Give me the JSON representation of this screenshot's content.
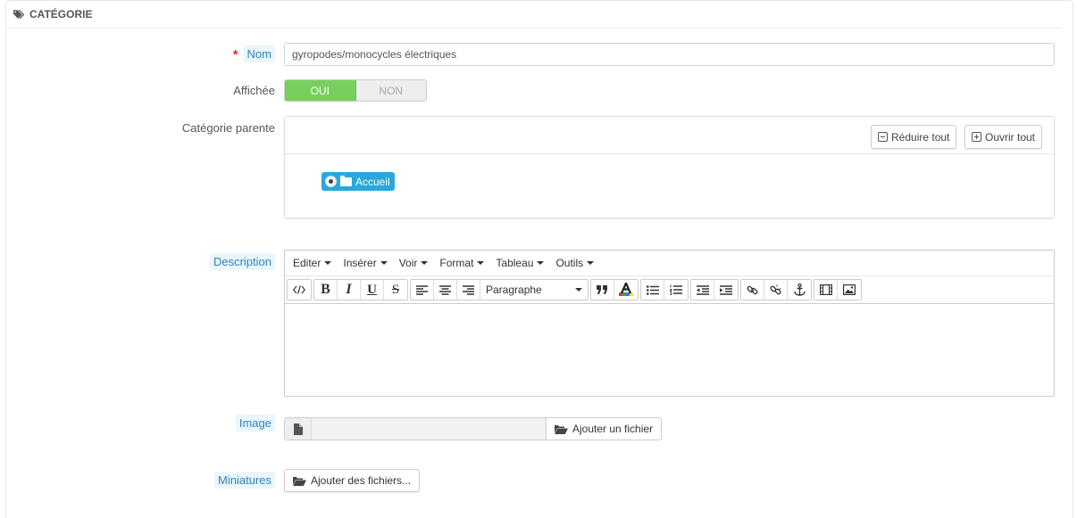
{
  "panel": {
    "heading": "CATÉGORIE",
    "icon": "tag-icon"
  },
  "fields": {
    "name": {
      "label": "Nom",
      "required_mark": "*",
      "value": "gyropodes/monocycles électriques"
    },
    "displayed": {
      "label": "Affichée",
      "on_label": "OUI",
      "off_label": "NON",
      "state": "on"
    },
    "parent": {
      "label": "Catégorie parente",
      "collapse_all": "Réduire tout",
      "expand_all": "Ouvrir tout",
      "node": "Accueil"
    },
    "description": {
      "label": "Description",
      "menus": [
        "Editer",
        "Insérer",
        "Voir",
        "Format",
        "Tableau",
        "Outils"
      ],
      "format_select": "Paragraphe"
    },
    "image": {
      "label": "Image",
      "button": "Ajouter un fichier"
    },
    "thumbnails": {
      "label": "Miniatures",
      "button": "Ajouter des fichiers..."
    }
  },
  "colors": {
    "accent": "#2aa8dc",
    "switch_on": "#78d05c",
    "required": "#e0302e",
    "hint_text": "#2a84b6"
  }
}
